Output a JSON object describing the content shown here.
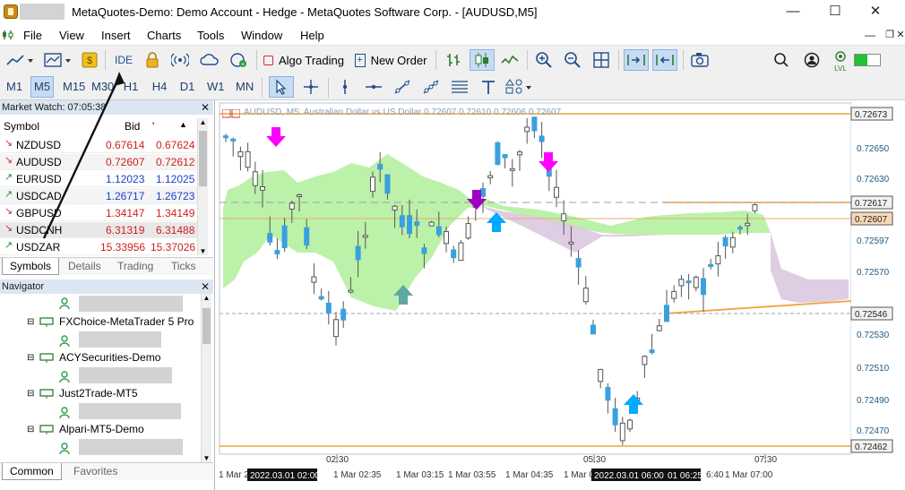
{
  "window": {
    "title": "MetaQuotes-Demo: Demo Account - Hedge - MetaQuotes Software Corp. - [AUDUSD,M5]",
    "minimize": "—",
    "maximize": "☐",
    "close": "✕"
  },
  "menu": [
    "File",
    "View",
    "Insert",
    "Charts",
    "Tools",
    "Window",
    "Help"
  ],
  "toolbar": {
    "ide": "IDE",
    "algo_trading": "Algo Trading",
    "new_order": "New Order",
    "lvl": "LVL"
  },
  "timeframes": [
    "M1",
    "M5",
    "M15",
    "M30",
    "H1",
    "H4",
    "D1",
    "W1",
    "MN"
  ],
  "selected_timeframe": "M5",
  "market_watch": {
    "title": "Market Watch: 07:05:38",
    "columns": [
      "Symbol",
      "Bid",
      "Ask"
    ],
    "rows": [
      {
        "symbol": "NZDUSD",
        "bid": "0.67614",
        "ask": "0.67624",
        "dir": "down"
      },
      {
        "symbol": "AUDUSD",
        "bid": "0.72607",
        "ask": "0.72612",
        "dir": "down"
      },
      {
        "symbol": "EURUSD",
        "bid": "1.12023",
        "ask": "1.12025",
        "dir": "up"
      },
      {
        "symbol": "USDCAD",
        "bid": "1.26717",
        "ask": "1.26723",
        "dir": "up"
      },
      {
        "symbol": "GBPUSD",
        "bid": "1.34147",
        "ask": "1.34149",
        "dir": "down"
      },
      {
        "symbol": "USDCNH",
        "bid": "6.31319",
        "ask": "6.31488",
        "dir": "down"
      },
      {
        "symbol": "USDZAR",
        "bid": "15.33956",
        "ask": "15.37026",
        "dir": "up"
      }
    ],
    "tabs": [
      "Symbols",
      "Details",
      "Trading",
      "Ticks"
    ]
  },
  "navigator": {
    "title": "Navigator",
    "servers": [
      "FXChoice-MetaTrader 5 Pro",
      "ACYSecurities-Demo",
      "Just2Trade-MT5",
      "Alpari-MT5-Demo"
    ],
    "tabs": [
      "Common",
      "Favorites"
    ]
  },
  "chart": {
    "header": "AUDUSD, M5:  Australian Dollar vs US Dollar  0.72607 0.72610 0.72606 0.72607",
    "price_labels": [
      "0.72650",
      "0.72630",
      "0.72597",
      "0.72570",
      "0.72530",
      "0.72510",
      "0.72490",
      "0.72470"
    ],
    "line_labels": [
      "0.72673",
      "0.72617",
      "0.72607",
      "0.72546",
      "0.72462"
    ],
    "time_labels": [
      "1 Mar 2",
      "1 Mar 02:35",
      "1 Mar 03:15",
      "1 Mar 03:55",
      "1 Mar 04:35",
      "1 Mar 0",
      "6:40",
      "1 Mar 07:00"
    ],
    "time_boxes": [
      "2022.03.01 02:00",
      "2022.03.01 06:00",
      "01 06:25"
    ],
    "vline_labels": [
      "02:30",
      "05:30",
      "07:30"
    ],
    "colors": {
      "candle": "#3aa0e0",
      "cloud_bull": "#b5f0a0",
      "cloud_bear": "#dcc8e0",
      "line": "#f2a23c",
      "up_arrow": "#00aaff",
      "down_arrow": "#ff00ff"
    }
  }
}
